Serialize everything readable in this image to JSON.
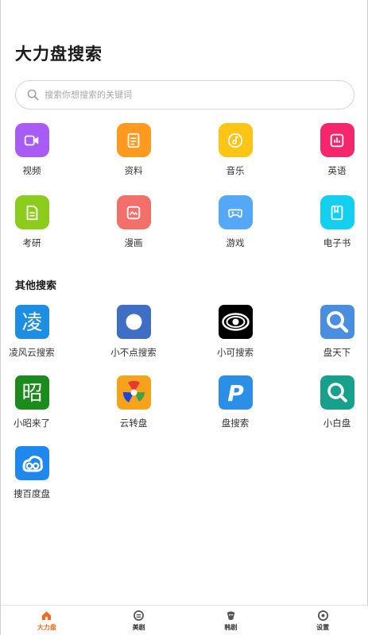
{
  "app": {
    "title": "大力盘搜索"
  },
  "search": {
    "placeholder": "搜索你想搜索的关键词"
  },
  "categories": [
    {
      "label": "视频",
      "icon": "video-icon",
      "color": "#a85cf5"
    },
    {
      "label": "资料",
      "icon": "document-icon",
      "color": "#ff9a1f"
    },
    {
      "label": "音乐",
      "icon": "music-icon",
      "color": "#ffc514"
    },
    {
      "label": "英语",
      "icon": "chart-icon",
      "color": "#f5266c"
    },
    {
      "label": "考研",
      "icon": "notes-icon",
      "color": "#8ccc1c"
    },
    {
      "label": "漫画",
      "icon": "picture-icon",
      "color": "#f3706a"
    },
    {
      "label": "游戏",
      "icon": "gamepad-icon",
      "color": "#54a8f7"
    },
    {
      "label": "电子书",
      "icon": "book-icon",
      "color": "#14d0f0"
    }
  ],
  "other": {
    "title": "其他搜索",
    "sites": [
      {
        "label": "凌风云搜索",
        "icon": "lingfeng-logo",
        "glyph": "凌",
        "color": "#1e8ee5"
      },
      {
        "label": "小不点搜索",
        "icon": "xiaobudian-logo",
        "color": "#3f6fc4"
      },
      {
        "label": "小可搜索",
        "icon": "xiaoke-eye-logo",
        "color": "#000000"
      },
      {
        "label": "盘天下",
        "icon": "pantianxia-search-logo",
        "color": "#4a8ee0"
      },
      {
        "label": "小昭来了",
        "icon": "xiaozhao-logo",
        "glyph": "昭",
        "color": "#1b8c1b"
      },
      {
        "label": "云转盘",
        "icon": "yunzhuanpan-logo",
        "color": "#f7a21b"
      },
      {
        "label": "盘搜索",
        "icon": "pansousuo-p-logo",
        "glyph": "P",
        "color": "#2b8fe8"
      },
      {
        "label": "小白盘",
        "icon": "xiaobaipan-search-logo",
        "color": "#17a08c"
      },
      {
        "label": "捜百度盘",
        "icon": "baidu-cloud-logo",
        "color": "#1f88ee"
      }
    ]
  },
  "tabs": [
    {
      "label": "大力盘",
      "icon": "home-icon",
      "active": true
    },
    {
      "label": "美剧",
      "icon": "tv-icon",
      "active": false
    },
    {
      "label": "韩剧",
      "icon": "drama-icon",
      "active": false
    },
    {
      "label": "设置",
      "icon": "settings-icon",
      "active": false
    }
  ],
  "colors": {
    "accent": "#f26a1b",
    "text": "#333333"
  }
}
